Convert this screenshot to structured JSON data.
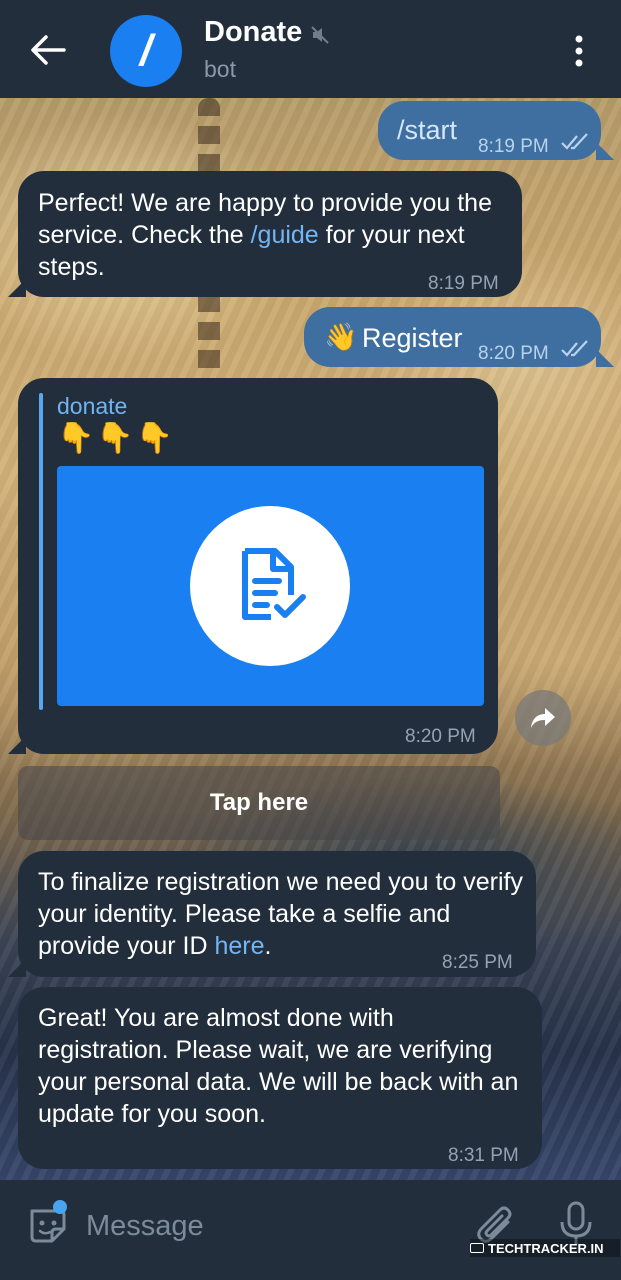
{
  "header": {
    "title": "Donate",
    "subtitle": "bot",
    "avatar_glyph": "/"
  },
  "messages": [
    {
      "direction": "out",
      "text": "/start",
      "time": "8:19 PM",
      "status": "read"
    },
    {
      "direction": "in",
      "text_before": "Perfect! We are happy to provide you the service. Check the ",
      "link": "/guide",
      "text_after": " for your next steps.",
      "time": "8:19 PM"
    },
    {
      "direction": "out",
      "emoji": "👋",
      "text": "Register",
      "time": "8:20 PM",
      "status": "read"
    },
    {
      "direction": "in",
      "quote_name": "donate",
      "quote_emoji": "👇👇👇",
      "preview_icon": "document-check-icon",
      "time": "8:20 PM"
    },
    {
      "direction": "in",
      "text_before": "To finalize registration we need you to verify your identity. Please take a selfie and provide your ID ",
      "link": "here",
      "text_after": ".",
      "time": "8:25 PM"
    },
    {
      "direction": "in",
      "text": "Great! You are almost done with registration. Please wait, we are verifying your personal data. We will be back with an update for you soon.",
      "time": "8:31 PM"
    }
  ],
  "inline_button": {
    "label": "Tap here"
  },
  "composer": {
    "placeholder": "Message"
  },
  "watermark": "TECHTRACKER.IN",
  "colors": {
    "header_bg": "#222e3c",
    "outgoing_bubble": "#3f6fa0",
    "incoming_bubble": "#222e3c",
    "link": "#72b5f5",
    "accent": "#1a7ff0"
  }
}
